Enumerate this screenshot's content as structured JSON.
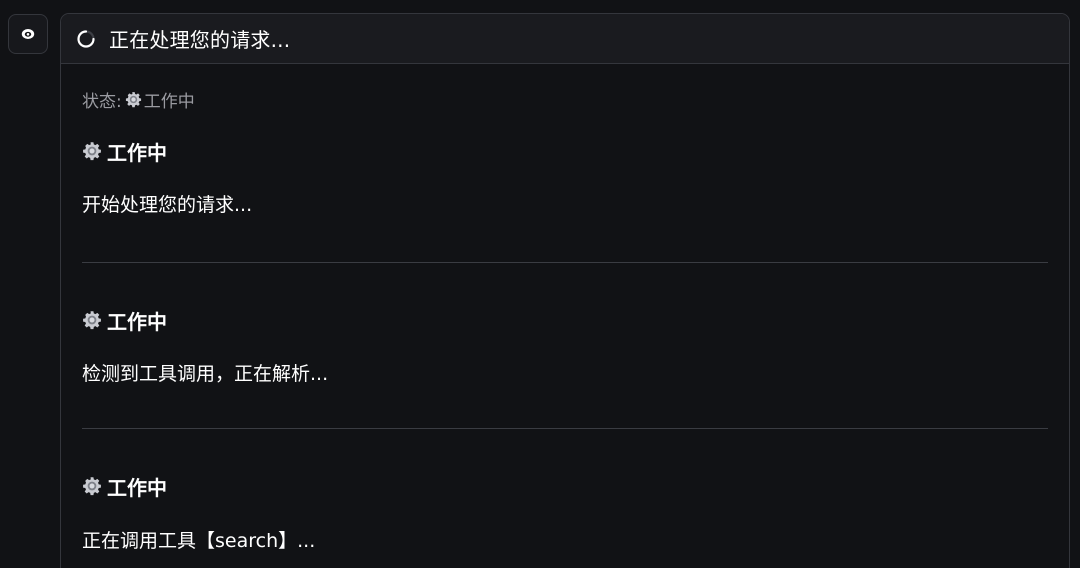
{
  "sidebar": {
    "avatar_icon": "eye-icon"
  },
  "header": {
    "spinner_icon": "loading-spinner-icon",
    "title": "正在处理您的请求..."
  },
  "status": {
    "label": "状态:",
    "icon": "gear-icon",
    "value": "工作中"
  },
  "sections": [
    {
      "icon": "gear-icon",
      "heading": "工作中",
      "text": "开始处理您的请求..."
    },
    {
      "icon": "gear-icon",
      "heading": "工作中",
      "text": "检测到工具调用，正在解析..."
    },
    {
      "icon": "gear-icon",
      "heading": "工作中",
      "text": "正在调用工具【search】..."
    }
  ],
  "colors": {
    "background": "#111215",
    "header_background": "#1a1b1f",
    "border": "#34363c",
    "muted_text": "#9a9ba1",
    "text": "#ffffff"
  }
}
